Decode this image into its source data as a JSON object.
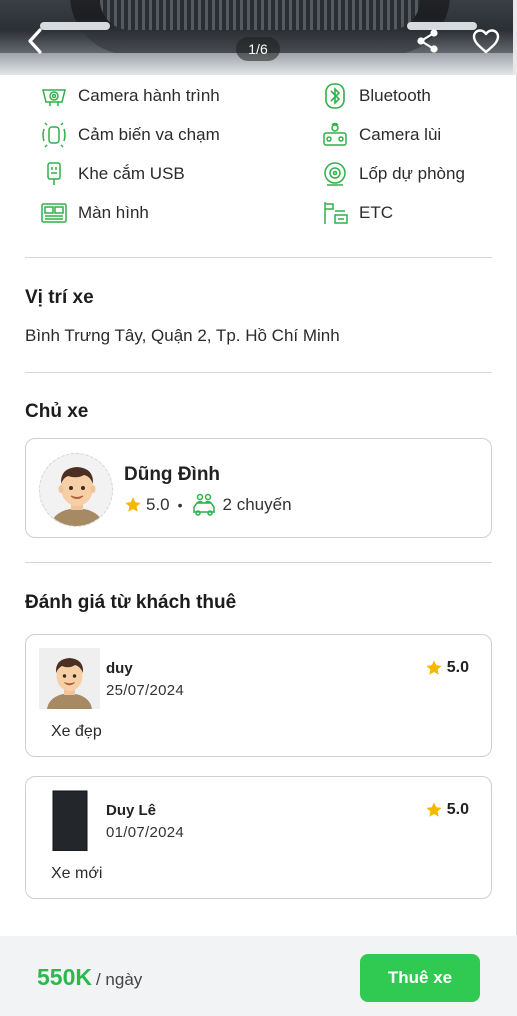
{
  "header": {
    "image_counter": "1/6",
    "back_icon": "chevron-left-icon",
    "share_icon": "share-icon",
    "favorite_icon": "heart-icon"
  },
  "features": [
    {
      "label": "Camera hành trình",
      "icon": "dashcam-icon"
    },
    {
      "label": "Bluetooth",
      "icon": "bluetooth-icon"
    },
    {
      "label": "Cảm biến va chạm",
      "icon": "collision-sensor-icon"
    },
    {
      "label": "Camera lùi",
      "icon": "reverse-camera-icon"
    },
    {
      "label": "Khe cắm USB",
      "icon": "usb-icon"
    },
    {
      "label": "Lốp dự phòng",
      "icon": "spare-tire-icon"
    },
    {
      "label": "Màn hình",
      "icon": "screen-icon"
    },
    {
      "label": "ETC",
      "icon": "etc-icon"
    }
  ],
  "location": {
    "title": "Vị trí xe",
    "address": "Bình Trưng Tây, Quận 2, Tp. Hồ Chí Minh"
  },
  "owner": {
    "title": "Chủ xe",
    "name": "Dũng Đình",
    "rating": "5.0",
    "separator": "•",
    "trips": "2 chuyến"
  },
  "reviews": {
    "title": "Đánh giá từ khách thuê",
    "items": [
      {
        "name": "duy",
        "date": "25/07/2024",
        "rating": "5.0",
        "comment": "Xe đẹp"
      },
      {
        "name": "Duy Lê",
        "date": "01/07/2024",
        "rating": "5.0",
        "comment": "Xe mới"
      }
    ]
  },
  "footer": {
    "price": "550K",
    "unit": "/ ngày",
    "rent_label": "Thuê xe"
  },
  "colors": {
    "accent_green": "#30c952",
    "price_green": "#2db84c",
    "star_yellow": "#f5b800",
    "icon_green": "#2fb14a"
  }
}
